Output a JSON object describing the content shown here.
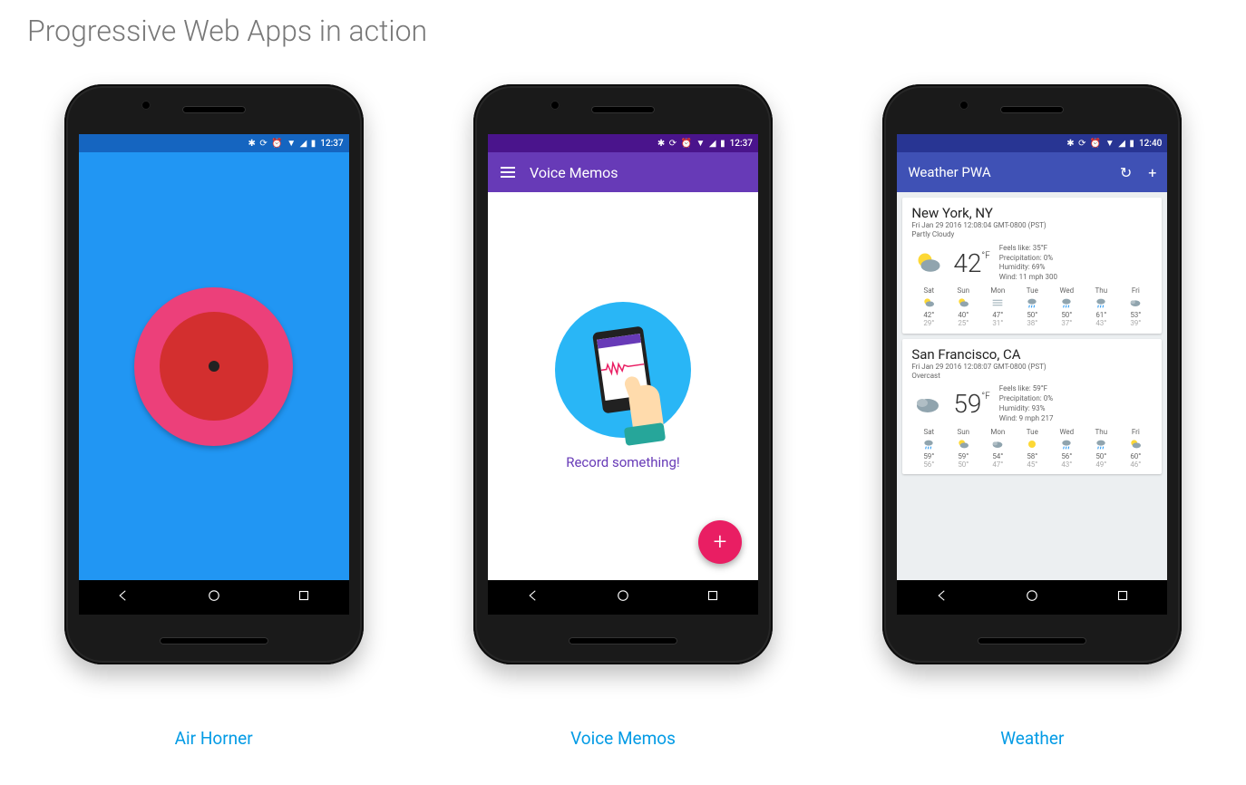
{
  "page_title": "Progressive Web Apps in action",
  "status_time_a": "12:37",
  "status_time_b": "12:37",
  "status_time_c": "12:40",
  "captions": {
    "airhorner": "Air Horner",
    "voicememos": "Voice Memos",
    "weather": "Weather"
  },
  "voicememos": {
    "title": "Voice Memos",
    "cta": "Record something!",
    "fab_label": "+"
  },
  "weather": {
    "title": "Weather PWA",
    "cards": [
      {
        "city": "New York, NY",
        "timestamp": "Fri Jan 29 2016 12:08:04 GMT-0800 (PST)",
        "condition": "Partly Cloudy",
        "temp": "42",
        "unit": "°F",
        "details": {
          "feels": "35°F",
          "precip": "0%",
          "humidity": "69%",
          "wind": "11 mph 300"
        },
        "forecast": [
          {
            "d": "Sat",
            "hi": "42°",
            "lo": "29°",
            "i": "pc"
          },
          {
            "d": "Sun",
            "hi": "40°",
            "lo": "25°",
            "i": "pc"
          },
          {
            "d": "Mon",
            "hi": "47°",
            "lo": "31°",
            "i": "fog"
          },
          {
            "d": "Tue",
            "hi": "50°",
            "lo": "38°",
            "i": "rain"
          },
          {
            "d": "Wed",
            "hi": "50°",
            "lo": "37°",
            "i": "rain"
          },
          {
            "d": "Thu",
            "hi": "61°",
            "lo": "43°",
            "i": "rain"
          },
          {
            "d": "Fri",
            "hi": "53°",
            "lo": "39°",
            "i": "cloud"
          }
        ]
      },
      {
        "city": "San Francisco, CA",
        "timestamp": "Fri Jan 29 2016 12:08:07 GMT-0800 (PST)",
        "condition": "Overcast",
        "temp": "59",
        "unit": "°F",
        "details": {
          "feels": "59°F",
          "precip": "0%",
          "humidity": "93%",
          "wind": "9 mph 217"
        },
        "forecast": [
          {
            "d": "Sat",
            "hi": "59°",
            "lo": "56°",
            "i": "rain"
          },
          {
            "d": "Sun",
            "hi": "59°",
            "lo": "50°",
            "i": "pc"
          },
          {
            "d": "Mon",
            "hi": "54°",
            "lo": "47°",
            "i": "cloud"
          },
          {
            "d": "Tue",
            "hi": "58°",
            "lo": "45°",
            "i": "sun"
          },
          {
            "d": "Wed",
            "hi": "56°",
            "lo": "43°",
            "i": "rain"
          },
          {
            "d": "Thu",
            "hi": "50°",
            "lo": "49°",
            "i": "rain"
          },
          {
            "d": "Fri",
            "hi": "60°",
            "lo": "46°",
            "i": "pc"
          }
        ]
      }
    ],
    "labels": {
      "feels": "Feels like: ",
      "precip": "Precipitation: ",
      "humidity": "Humidity: ",
      "wind": "Wind: "
    }
  }
}
